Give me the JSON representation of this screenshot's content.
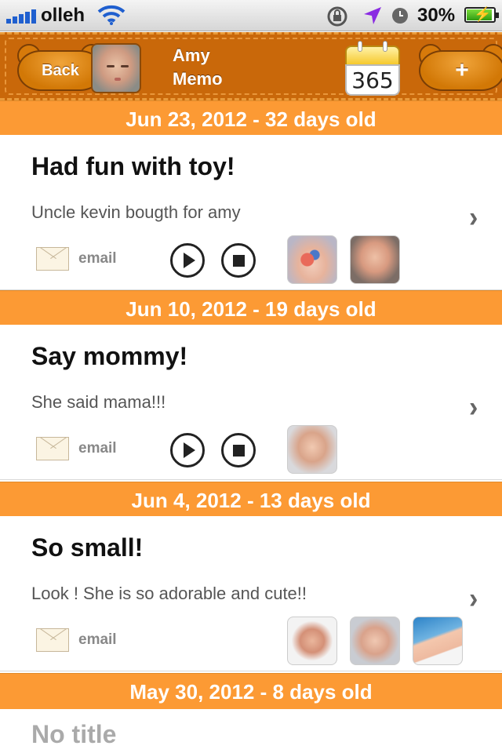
{
  "status_bar": {
    "carrier": "olleh",
    "battery_percent": "30%",
    "icons": [
      "signal-icon",
      "wifi-icon",
      "rotation-lock-icon",
      "location-icon",
      "alarm-icon",
      "battery-charging-icon"
    ]
  },
  "nav": {
    "back_label": "Back",
    "title_line1": "Amy",
    "title_line2": "Memo",
    "calendar_label": "365",
    "add_label": "+"
  },
  "colors": {
    "nav_brown": "#c9680a",
    "section_orange": "#fc9a34",
    "text_dark": "#111111",
    "text_muted": "#555555"
  },
  "entries": [
    {
      "header": "Jun 23, 2012 -  32 days old",
      "title": "Had fun with toy!",
      "subtitle": "Uncle kevin bougth for amy",
      "email_label": "email",
      "has_audio": true,
      "photos": [
        "baby-with-toy-photo",
        "baby-laughing-photo"
      ]
    },
    {
      "header": "Jun 10, 2012 -  19 days old",
      "title": "Say mommy!",
      "subtitle": "She said mama!!!",
      "email_label": "email",
      "has_audio": true,
      "photos": [
        "baby-lying-photo"
      ]
    },
    {
      "header": "Jun 4, 2012 -  13 days old",
      "title": "So small!",
      "subtitle": "Look ! She is so adorable and cute!!",
      "email_label": "email",
      "has_audio": false,
      "photos": [
        "baby-wrapped-photo",
        "baby-calm-photo",
        "baby-feet-photo"
      ]
    },
    {
      "header": "May 30, 2012 -  8 days old",
      "title": "No title"
    }
  ]
}
